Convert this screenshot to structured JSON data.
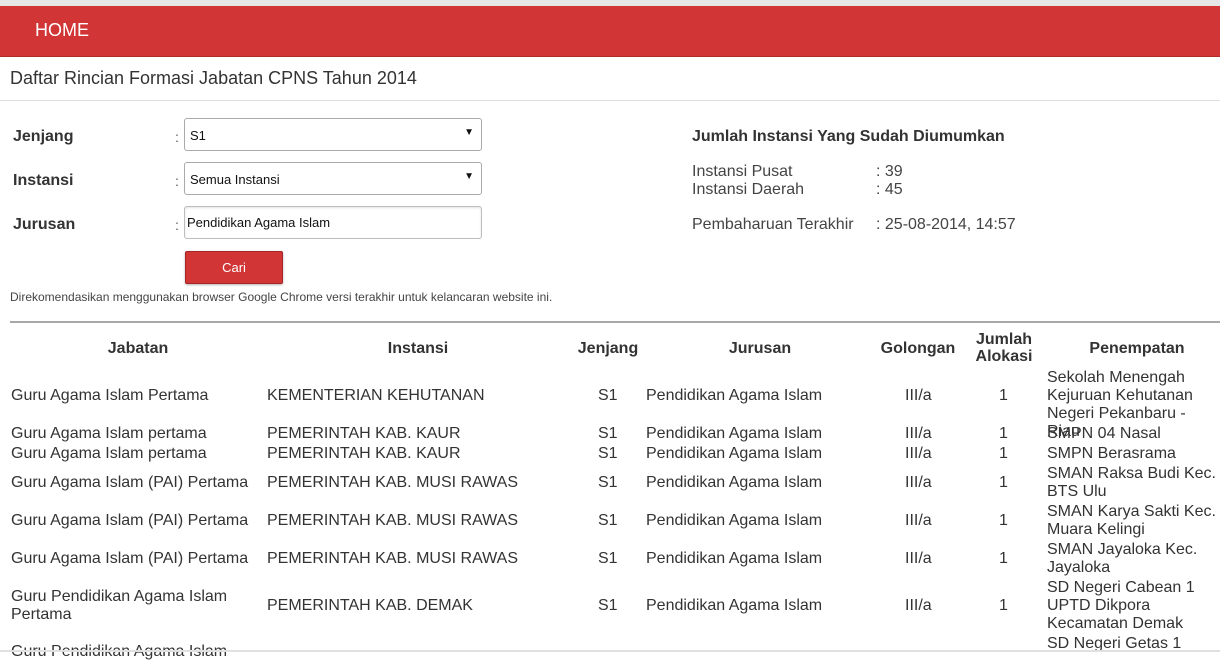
{
  "nav": {
    "home_label": "HOME"
  },
  "page": {
    "title": "Daftar Rincian Formasi Jabatan CPNS Tahun 2014",
    "note": "Direkomendasikan menggunakan browser Google Chrome versi terakhir untuk kelancaran website ini."
  },
  "form": {
    "colon": ":",
    "jenjang": {
      "label": "Jenjang",
      "value": "S1"
    },
    "instansi": {
      "label": "Instansi",
      "value": "Semua Instansi"
    },
    "jurusan": {
      "label": "Jurusan",
      "value": "Pendidikan Agama Islam"
    },
    "submit_label": "Cari"
  },
  "info": {
    "title": "Jumlah Instansi Yang Sudah Diumumkan",
    "pusat_label": "Instansi Pusat",
    "pusat_value": ": 39",
    "daerah_label": "Instansi Daerah",
    "daerah_value": ": 45",
    "update_label": "Pembaharuan Terakhir",
    "update_value": ": 25-08-2014, 14:57"
  },
  "table": {
    "headers": {
      "jabatan": "Jabatan",
      "instansi": "Instansi",
      "jenjang": "Jenjang",
      "jurusan": "Jurusan",
      "golongan": "Golongan",
      "jumlah_line1": "Jumlah",
      "jumlah_line2": "Alokasi",
      "penempatan": "Penempatan"
    },
    "rows": [
      {
        "jabatan": "Guru Agama Islam Pertama",
        "instansi": "KEMENTERIAN KEHUTANAN",
        "jenjang": "S1",
        "jurusan": "Pendidikan Agama Islam",
        "golongan": "III/a",
        "jumlah": "1",
        "penempatan": "Sekolah Menengah Kejuruan Kehutanan Negeri Pekanbaru - Riau"
      },
      {
        "jabatan": "Guru Agama Islam pertama",
        "instansi": "PEMERINTAH KAB. KAUR",
        "jenjang": "S1",
        "jurusan": "Pendidikan Agama Islam",
        "golongan": "III/a",
        "jumlah": "1",
        "penempatan": "SMPN 04 Nasal"
      },
      {
        "jabatan": "Guru Agama Islam pertama",
        "instansi": "PEMERINTAH KAB. KAUR",
        "jenjang": "S1",
        "jurusan": "Pendidikan Agama Islam",
        "golongan": "III/a",
        "jumlah": "1",
        "penempatan": "SMPN Berasrama"
      },
      {
        "jabatan": "Guru Agama Islam (PAI) Pertama",
        "instansi": "PEMERINTAH KAB. MUSI RAWAS",
        "jenjang": "S1",
        "jurusan": "Pendidikan Agama Islam",
        "golongan": "III/a",
        "jumlah": "1",
        "penempatan": "SMAN Raksa Budi Kec. BTS Ulu"
      },
      {
        "jabatan": "Guru Agama Islam (PAI) Pertama",
        "instansi": "PEMERINTAH KAB. MUSI RAWAS",
        "jenjang": "S1",
        "jurusan": "Pendidikan Agama Islam",
        "golongan": "III/a",
        "jumlah": "1",
        "penempatan": "SMAN Karya Sakti Kec. Muara Kelingi"
      },
      {
        "jabatan": "Guru Agama Islam (PAI) Pertama",
        "instansi": "PEMERINTAH KAB. MUSI RAWAS",
        "jenjang": "S1",
        "jurusan": "Pendidikan Agama Islam",
        "golongan": "III/a",
        "jumlah": "1",
        "penempatan": "SMAN Jayaloka Kec. Jayaloka"
      },
      {
        "jabatan": "Guru Pendidikan Agama Islam Pertama",
        "instansi": "PEMERINTAH KAB. DEMAK",
        "jenjang": "S1",
        "jurusan": "Pendidikan Agama Islam",
        "golongan": "III/a",
        "jumlah": "1",
        "penempatan": "SD Negeri Cabean 1 UPTD Dikpora Kecamatan Demak"
      },
      {
        "jabatan": "Guru Pendidikan Agama Islam",
        "penempatan": "SD Negeri Getas 1"
      }
    ]
  }
}
